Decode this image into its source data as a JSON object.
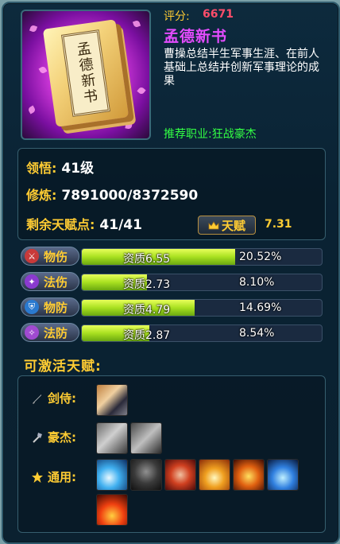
{
  "item": {
    "score_label": "评分:",
    "score_value": "6671",
    "name": "孟德新书",
    "cover_text": "孟德新书",
    "description": "曹操总结半生军事生涯、在前人基础上总结并创新军事理论的成果",
    "recommend": "推荐职业:狂战豪杰"
  },
  "stats": {
    "comprehension_label": "领悟:",
    "comprehension_value": "41级",
    "cultivation_label": "修炼:",
    "cultivation_value": "7891000/8372590",
    "talent_points_label": "剩余天赋点:",
    "talent_points_value": "41/41",
    "talent_button_label": "天赋",
    "talent_value": "7.31"
  },
  "attributes": [
    {
      "label": "物伤",
      "aptitude": "资质6.55",
      "percent": "20.52%",
      "fill": 0.64,
      "icon_color": "#c83a3a",
      "icon": "sword-icon"
    },
    {
      "label": "法伤",
      "aptitude": "资质2.73",
      "percent": "8.10%",
      "fill": 0.27,
      "icon_color": "#8a3acf",
      "icon": "magic-icon"
    },
    {
      "label": "物防",
      "aptitude": "资质4.79",
      "percent": "14.69%",
      "fill": 0.47,
      "icon_color": "#2a7ad0",
      "icon": "shield-icon"
    },
    {
      "label": "法防",
      "aptitude": "资质2.87",
      "percent": "8.54%",
      "fill": 0.28,
      "icon_color": "#a04ad0",
      "icon": "magic-shield-icon"
    }
  ],
  "talents": {
    "title": "可激活天赋:",
    "classes": [
      {
        "label": "剑侍:",
        "icon": "sword-icon",
        "skills": [
          "slash-skill-icon"
        ]
      },
      {
        "label": "豪杰:",
        "icon": "axe-icon",
        "skills": [
          "charge-skill-icon",
          "cleave-skill-icon"
        ]
      },
      {
        "label": "通用:",
        "icon": "star-icon",
        "skills": [
          "wave-skill-icon",
          "shadow-skill-icon",
          "fist-skill-icon",
          "golden-burst-skill-icon",
          "flame-arch-skill-icon",
          "blue-aura-skill-icon",
          "fire-crown-skill-icon"
        ]
      }
    ]
  },
  "colors": {
    "accent_gold": "#ffcc33",
    "score_red": "#ff4d6a",
    "name_purple": "#e54cff",
    "recommend_green": "#33ff44"
  }
}
